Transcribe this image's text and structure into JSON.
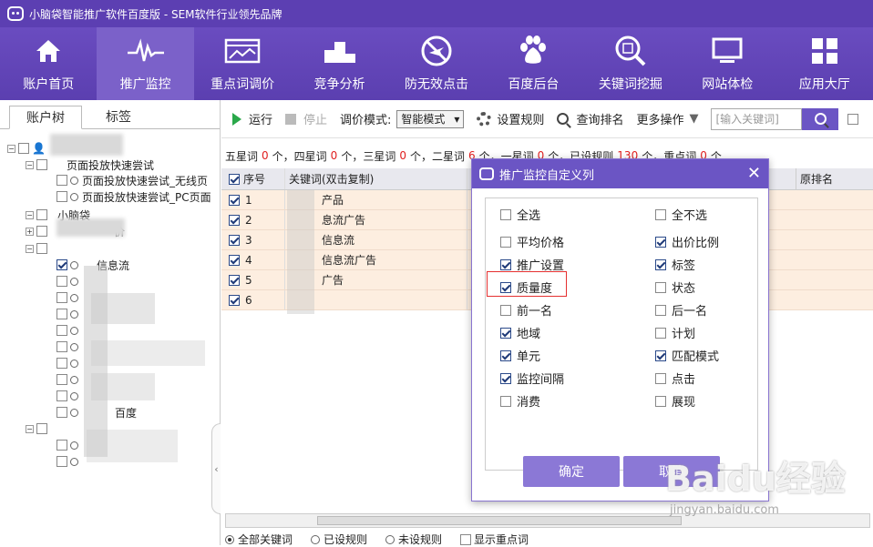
{
  "window": {
    "title": "小脑袋智能推广软件百度版 - SEM软件行业领先品牌"
  },
  "toolbar": [
    {
      "label": "账户首页",
      "icon": "home-icon"
    },
    {
      "label": "推广监控",
      "icon": "pulse-icon"
    },
    {
      "label": "重点词调价",
      "icon": "chart-window-icon"
    },
    {
      "label": "竞争分析",
      "icon": "podium-icon"
    },
    {
      "label": "防无效点击",
      "icon": "no-plane-icon"
    },
    {
      "label": "百度后台",
      "icon": "baidu-paw-icon"
    },
    {
      "label": "关键词挖掘",
      "icon": "word-search-icon"
    },
    {
      "label": "网站体检",
      "icon": "monitor-icon"
    },
    {
      "label": "应用大厅",
      "icon": "grid-icon"
    }
  ],
  "left": {
    "tabs": [
      "账户树",
      "标签"
    ],
    "tree": [
      {
        "label": "页面投放快速尝试"
      },
      {
        "label": "页面投放快速尝试_无线页"
      },
      {
        "label": "页面投放快速尝试_PC页面"
      },
      {
        "label": "小脑袋"
      },
      {
        "label": "价"
      },
      {
        "label": "信息流"
      },
      {
        "label": "百度"
      }
    ]
  },
  "main": {
    "run": "运行",
    "stop": "停止",
    "mode_label": "调价模式:",
    "mode_value": "智能模式",
    "rules": "设置规则",
    "rank": "查询排名",
    "more": "更多操作",
    "search_placeholder": "[输入关键词]",
    "stats": {
      "five": "五星词",
      "five_n": "0",
      "four": "个，四星词",
      "four_n": "0",
      "three": "个，三星词",
      "three_n": "0",
      "two": "个，二星词",
      "two_n": "6",
      "one": "个，一星词",
      "one_n": "0",
      "rules": "个，已设规则",
      "rules_n": "130",
      "key": "个，重点词",
      "key_n": "0",
      "end": "个"
    },
    "columns": {
      "seq": "序号",
      "keyword": "关键词(双击复制)",
      "orig_rank": "原排名"
    },
    "rows": [
      {
        "seq": "1",
        "kw": "产品"
      },
      {
        "seq": "2",
        "kw": "息流广告"
      },
      {
        "seq": "3",
        "kw": "信息流"
      },
      {
        "seq": "4",
        "kw": "信息流广告"
      },
      {
        "seq": "5",
        "kw": "广告"
      },
      {
        "seq": "6",
        "kw": ""
      }
    ],
    "bottom": {
      "all": "全部关键词",
      "set": "已设规则",
      "unset": "未设规则",
      "key": "显示重点词"
    }
  },
  "dialog": {
    "title": "推广监控自定义列",
    "select_all": "全选",
    "select_none": "全不选",
    "options_left": [
      {
        "label": "平均价格",
        "checked": false
      },
      {
        "label": "推广设置",
        "checked": true
      },
      {
        "label": "质量度",
        "checked": true
      },
      {
        "label": "前一名",
        "checked": false
      },
      {
        "label": "地域",
        "checked": true
      },
      {
        "label": "单元",
        "checked": true
      },
      {
        "label": "监控间隔",
        "checked": true
      },
      {
        "label": "消费",
        "checked": false
      }
    ],
    "options_right": [
      {
        "label": "出价比例",
        "checked": true
      },
      {
        "label": "标签",
        "checked": true
      },
      {
        "label": "状态",
        "checked": false
      },
      {
        "label": "后一名",
        "checked": false
      },
      {
        "label": "计划",
        "checked": false
      },
      {
        "label": "匹配模式",
        "checked": true
      },
      {
        "label": "点击",
        "checked": false
      },
      {
        "label": "展现",
        "checked": false
      }
    ],
    "ok": "确定",
    "cancel": "取消"
  },
  "watermark": {
    "brand": "Baidu经验",
    "url": "jingyan.baidu.com"
  }
}
